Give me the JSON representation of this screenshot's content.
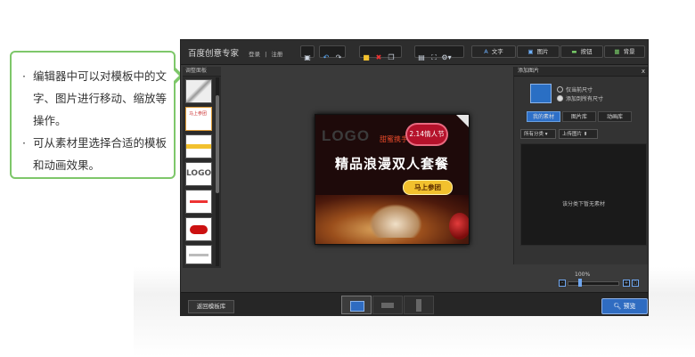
{
  "callout": {
    "bullet1": "编辑器中可以对模板中的文字、图片进行移动、缩放等操作。",
    "bullet2": "可从素材里选择合适的模板和动画效果。"
  },
  "app": {
    "title": "百度创意专家",
    "login": "登录",
    "sep": "|",
    "register": "注册",
    "toolbar": {
      "text_label": "文字",
      "image_label": "图片",
      "button_label": "按钮",
      "background_label": "背景"
    },
    "left_panel": {
      "title": "调整面板"
    },
    "canvas": {
      "logo": "LOGO",
      "handwritten": "甜蜜携手",
      "heart_badge": "2.14情人节",
      "headline": "精品浪漫双人套餐",
      "cta": "马上参团"
    },
    "right_panel": {
      "title": "添加图片",
      "close": "x",
      "radio1": "仅当前尺寸",
      "radio2": "添加到所有尺寸",
      "tabs": [
        "我的素材",
        "图片库",
        "动画库"
      ],
      "category": "所有分类",
      "upload": "上传图片",
      "empty_text": "该分类下暂无素材"
    },
    "zoom": {
      "value": "100%"
    },
    "bottom": {
      "back": "返回模板库",
      "preview": "预览"
    }
  },
  "colors": {
    "callout_border": "#7ec76a",
    "accent_blue": "#2f6cc1",
    "app_bg": "#3a3a3a"
  }
}
